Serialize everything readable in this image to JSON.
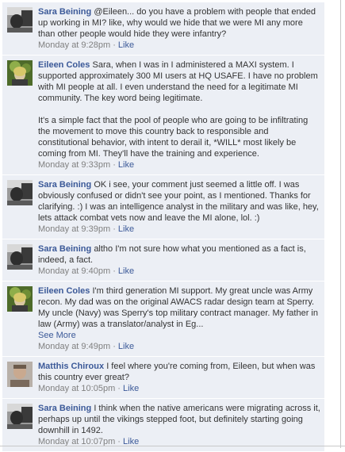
{
  "comments": [
    {
      "author": "Sara Beining",
      "avatar": "sara-avatar",
      "paragraphs": [
        "@Eileen... do you have a problem with people that ended up working in MI? like, why would we hide that we were MI any more than other people would hide they were infantry?"
      ],
      "time": "Monday at 9:28pm",
      "sep": "·",
      "like": "Like"
    },
    {
      "author": "Eileen Coles",
      "avatar": "eileen-avatar",
      "paragraphs": [
        "Sara, when I was in I administered a MAXI system. I supported approximately 300 MI users at HQ USAFE. I have no problem with MI people at all. I even understand the need for a legitimate MI community. The key word being legitimate.",
        "It's a simple fact that the pool of people who are going to be infiltrating the movement to move this country back to responsible and constitutional behavior, with intent to derail it, *WILL* most likely be coming from MI. They'll have the training and experience."
      ],
      "time": "Monday at 9:33pm",
      "sep": "·",
      "like": "Like"
    },
    {
      "author": "Sara Beining",
      "avatar": "sara-avatar",
      "paragraphs": [
        "OK i see, your comment just seemed a little off. I was obviously confused or didn't see your point, as I mentioned. Thanks for clarifying. :) I was an intelligence analyst in the military and was like, hey, lets attack combat vets now and leave the MI alone, lol. :)"
      ],
      "time": "Monday at 9:39pm",
      "sep": "·",
      "like": "Like"
    },
    {
      "author": "Sara Beining",
      "avatar": "sara-avatar",
      "paragraphs": [
        "altho I'm not sure how what you mentioned as a fact is, indeed, a fact."
      ],
      "time": "Monday at 9:40pm",
      "sep": "·",
      "like": "Like"
    },
    {
      "author": "Eileen Coles",
      "avatar": "eileen-avatar",
      "paragraphs": [
        "I'm third generation MI support. My great uncle was Army recon. My dad was on the original AWACS radar design team at Sperry. My uncle (Navy) was Sperry's top military contract manager. My father in law (Army) was a translator/analyst in Eg..."
      ],
      "see_more": "See More",
      "time": "Monday at 9:49pm",
      "sep": "·",
      "like": "Like"
    },
    {
      "author": "Matthis Chiroux",
      "avatar": "matthis-avatar",
      "paragraphs": [
        "I feel where you're coming from, Eileen, but when was this country ever great?"
      ],
      "time": "Monday at 10:05pm",
      "sep": "·",
      "like": "Like"
    },
    {
      "author": "Sara Beining",
      "avatar": "sara-avatar",
      "paragraphs": [
        "I think when the native americans were migrating across it, perhaps up until the vikings stepped foot, but definitely starting going downhill in 1492."
      ],
      "time": "Monday at 10:07pm",
      "sep": "·",
      "like": "Like"
    }
  ]
}
